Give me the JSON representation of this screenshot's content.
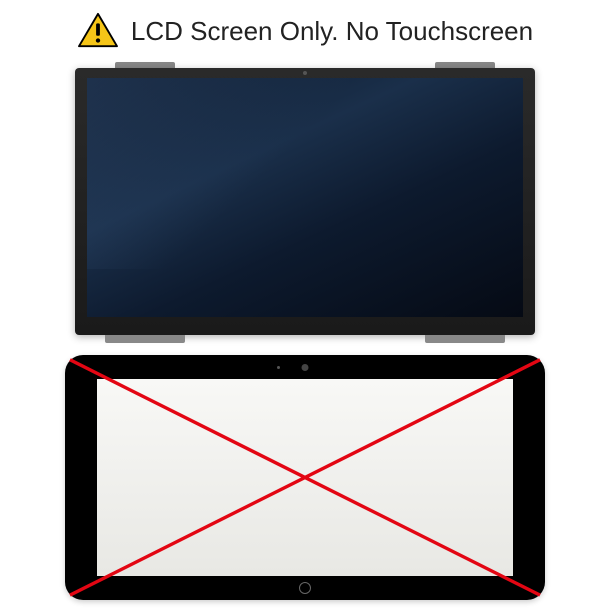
{
  "header": {
    "text": "LCD Screen Only. No Touchscreen",
    "warning_icon": "warning-triangle"
  },
  "colors": {
    "warning_yellow": "#f5c518",
    "cross_red": "#e30613",
    "lcd_dark": "#0a1628"
  }
}
